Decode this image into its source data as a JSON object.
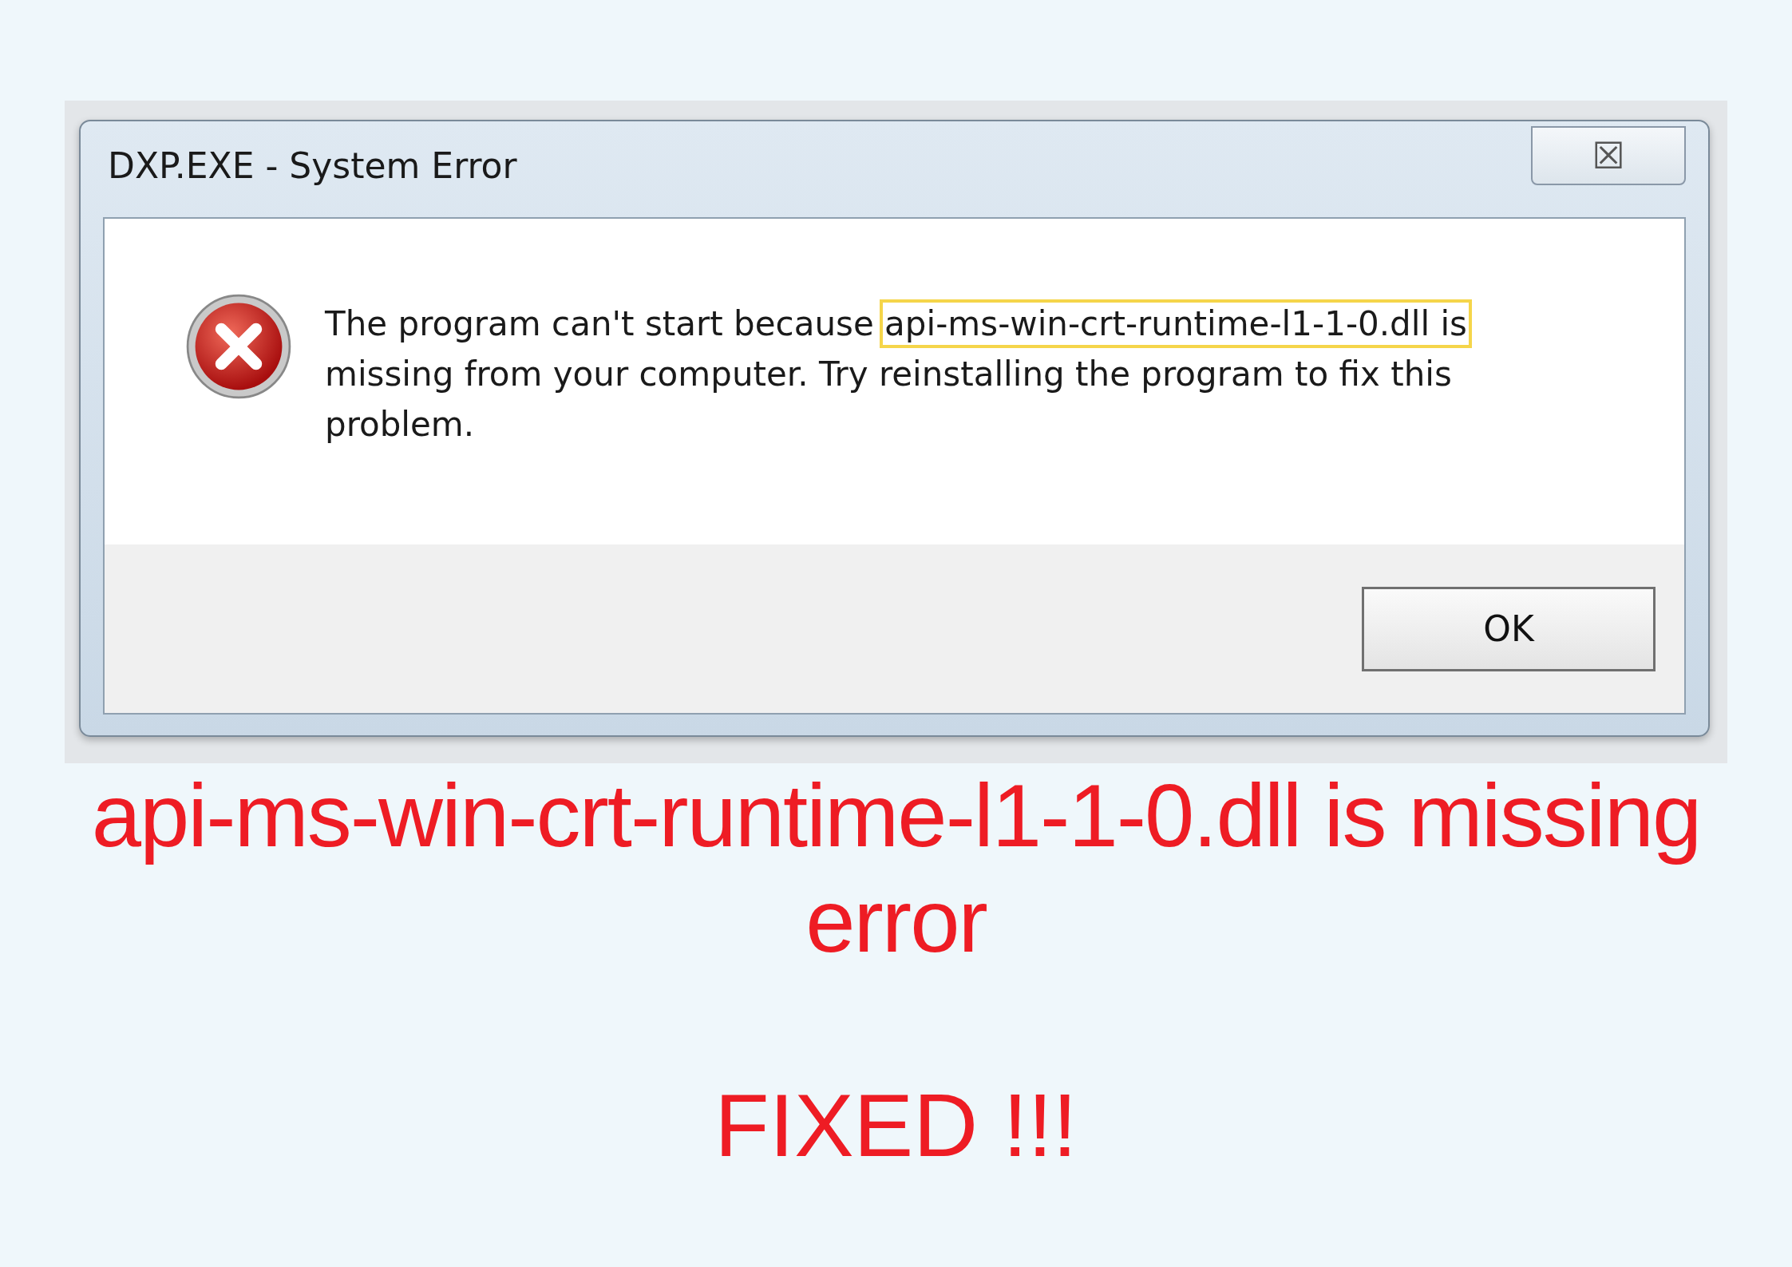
{
  "dialog": {
    "title": "DXP.EXE - System Error",
    "close_glyph": "☒",
    "message": [
      {
        "text": "The program can't start because ",
        "highlighted": false
      },
      {
        "text": "api-ms-win-crt-runtime-l1-1-0.dll is",
        "highlighted": true
      },
      {
        "text": " missing from your computer. Try reinstalling the program to fix this problem.",
        "highlighted": false
      }
    ],
    "buttons": [
      "OK"
    ]
  },
  "headline": "api-ms-win-crt-runtime-l1-1-0.dll is missing error",
  "tagline": "FIXED !!!"
}
